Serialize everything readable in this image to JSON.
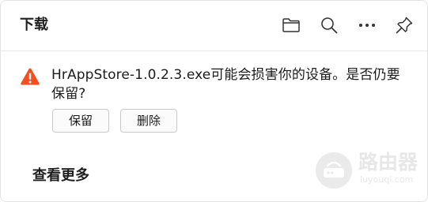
{
  "header": {
    "title": "下载"
  },
  "icons": [
    "folder-icon",
    "search-icon",
    "more-icon",
    "pin-icon",
    "warning-icon"
  ],
  "colors": {
    "warning": "#f25022"
  },
  "download": {
    "message": "HrAppStore-1.0.2.3.exe可能会损害你的设备。是否仍要保留?",
    "keep_label": "保留",
    "delete_label": "删除"
  },
  "footer": {
    "see_more_label": "查看更多"
  },
  "watermark": {
    "text": "路由器",
    "sub": "luyouqi.com"
  }
}
